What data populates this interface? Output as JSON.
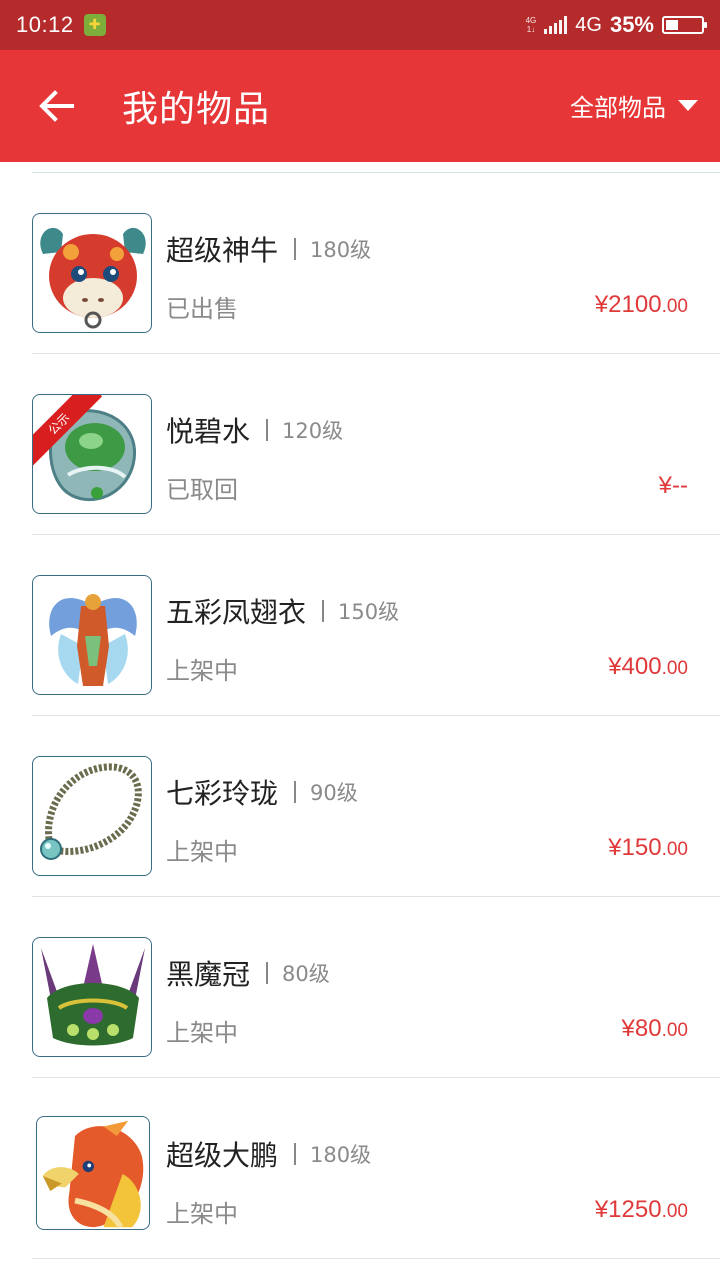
{
  "status_bar": {
    "time": "10:12",
    "net_small_top": "4G",
    "net_small_bottom": "1↓",
    "network": "4G",
    "battery": "35%",
    "battery_level": 0.35
  },
  "header": {
    "title": "我的物品",
    "filter_label": "全部物品"
  },
  "items": [
    {
      "name": "超级神牛",
      "level": "180级",
      "status": "已出售",
      "price_main": "¥2100",
      "price_dec": ".00",
      "icon": "bull-mount-icon"
    },
    {
      "name": "悦碧水",
      "level": "120级",
      "status": "已取回",
      "price_main": "¥--",
      "price_dec": "",
      "badge": "公示",
      "icon": "jade-charm-icon"
    },
    {
      "name": "五彩凤翅衣",
      "level": "150级",
      "status": "上架中",
      "price_main": "¥400",
      "price_dec": ".00",
      "icon": "phoenix-robe-icon"
    },
    {
      "name": "七彩玲珑",
      "level": "90级",
      "status": "上架中",
      "price_main": "¥150",
      "price_dec": ".00",
      "icon": "bead-necklace-icon"
    },
    {
      "name": "黑魔冠",
      "level": "80级",
      "status": "上架中",
      "price_main": "¥80",
      "price_dec": ".00",
      "icon": "demon-crown-icon"
    },
    {
      "name": "超级大鹏",
      "level": "180级",
      "status": "上架中",
      "price_main": "¥1250",
      "price_dec": ".00",
      "icon": "roc-bird-icon"
    }
  ],
  "colors": {
    "status_bar": "#b52a2a",
    "app_bar": "#e63637",
    "price": "#e0393a"
  }
}
